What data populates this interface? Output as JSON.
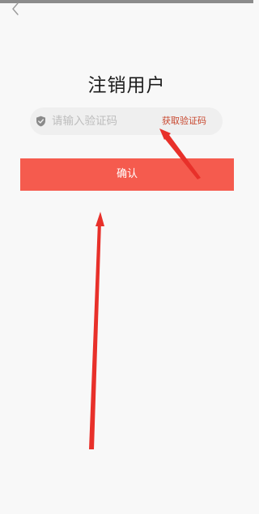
{
  "header": {
    "back_icon": "chevron-left-icon"
  },
  "page": {
    "title": "注销用户"
  },
  "verify": {
    "shield_icon": "shield-check-icon",
    "placeholder": "请输入验证码",
    "get_code_label": "获取验证码"
  },
  "actions": {
    "confirm_label": "确认",
    "confirm_color": "#f55b4e"
  },
  "colors": {
    "get_code_text": "#c8472e",
    "annotation_arrow": "#e8302a"
  }
}
